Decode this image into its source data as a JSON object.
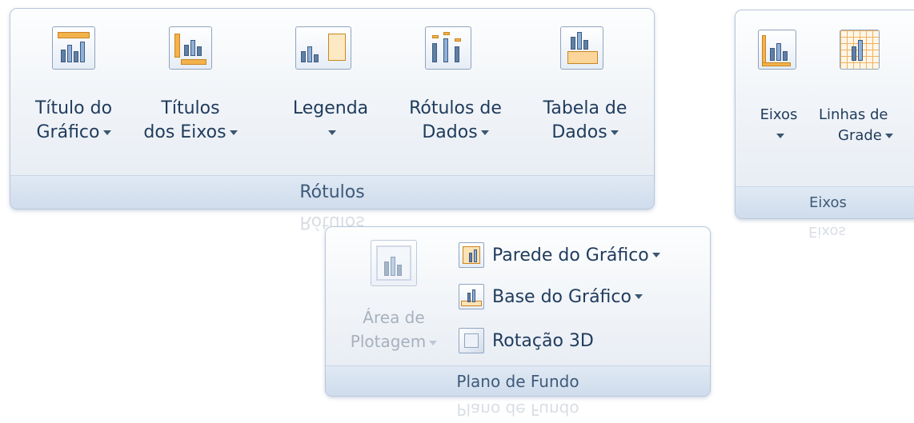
{
  "rotulos": {
    "group_label": "Rótulos",
    "buttons": [
      {
        "line1": "Título do",
        "line2": "Gráfico"
      },
      {
        "line1": "Títulos",
        "line2": "dos Eixos"
      },
      {
        "line1": "Legenda",
        "line2": ""
      },
      {
        "line1": "Rótulos de",
        "line2": "Dados"
      },
      {
        "line1": "Tabela de",
        "line2": "Dados"
      }
    ]
  },
  "eixos": {
    "group_label": "Eixos",
    "buttons": [
      {
        "line1": "Eixos",
        "line2": ""
      },
      {
        "line1": "Linhas de",
        "line2": "Grade"
      }
    ]
  },
  "plano_de_fundo": {
    "group_label": "Plano de Fundo",
    "area_line1": "Área de",
    "area_line2": "Plotagem",
    "small_buttons": [
      {
        "label": "Parede do Gráfico",
        "icon": "chart-wall-icon"
      },
      {
        "label": "Base do Gráfico",
        "icon": "chart-floor-icon"
      },
      {
        "label": "Rotação 3D",
        "icon": "3d-rotation-icon"
      }
    ]
  }
}
